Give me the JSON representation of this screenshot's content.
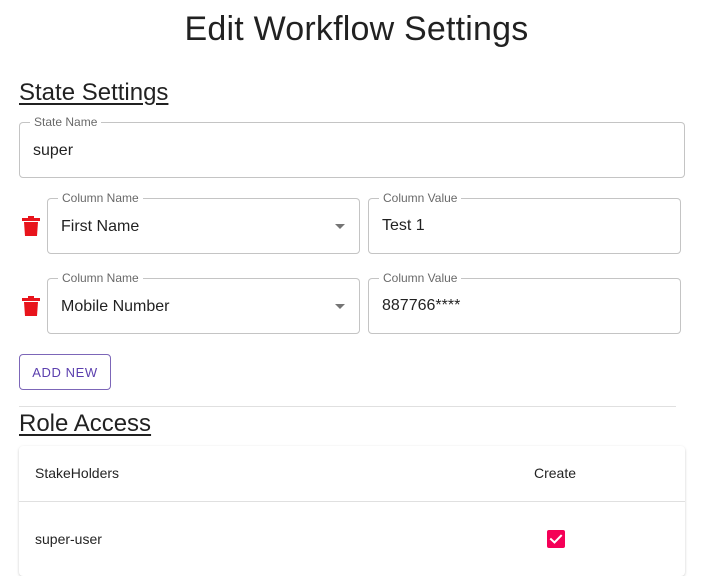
{
  "page": {
    "title": "Edit Workflow Settings"
  },
  "state_settings": {
    "heading": "State Settings",
    "state_name": {
      "label": "State Name",
      "value": "super"
    },
    "rows": [
      {
        "column_name": {
          "label": "Column Name",
          "value": "First Name"
        },
        "column_value": {
          "label": "Column Value",
          "value": "Test 1"
        },
        "delete_icon": "trash-icon"
      },
      {
        "column_name": {
          "label": "Column Name",
          "value": "Mobile Number"
        },
        "column_value": {
          "label": "Column Value",
          "value": "887766****"
        },
        "delete_icon": "trash-icon"
      }
    ],
    "add_button_label": "ADD NEW"
  },
  "role_access": {
    "heading": "Role Access",
    "columns": [
      "StakeHolders",
      "Create"
    ],
    "rows": [
      {
        "stakeholder": "super-user",
        "create": true
      }
    ]
  },
  "colors": {
    "accent": "#f50057",
    "delete": "#e8141c",
    "button": "#5b3fae"
  }
}
